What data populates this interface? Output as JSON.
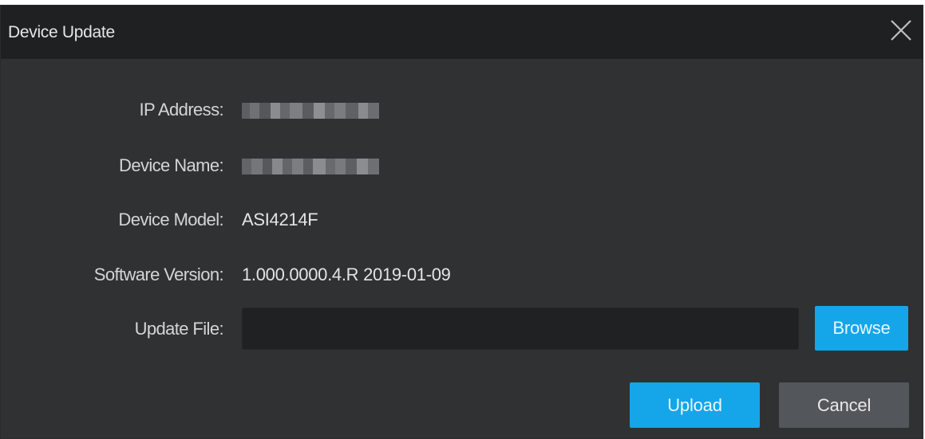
{
  "dialog": {
    "title": "Device Update",
    "close_icon": "close-icon"
  },
  "fields": {
    "ip_address": {
      "label": "IP Address:",
      "value": ""
    },
    "device_name": {
      "label": "Device Name:",
      "value": ""
    },
    "device_model": {
      "label": "Device Model:",
      "value": "ASI4214F"
    },
    "software_version": {
      "label": "Software Version:",
      "value": "1.000.0000.4.R 2019-01-09"
    },
    "update_file": {
      "label": "Update File:",
      "value": ""
    }
  },
  "buttons": {
    "browse": "Browse",
    "upload": "Upload",
    "cancel": "Cancel"
  },
  "colors": {
    "accent": "#14a6e9",
    "dialog_bg": "#303133",
    "titlebar_bg": "#1f2022"
  }
}
